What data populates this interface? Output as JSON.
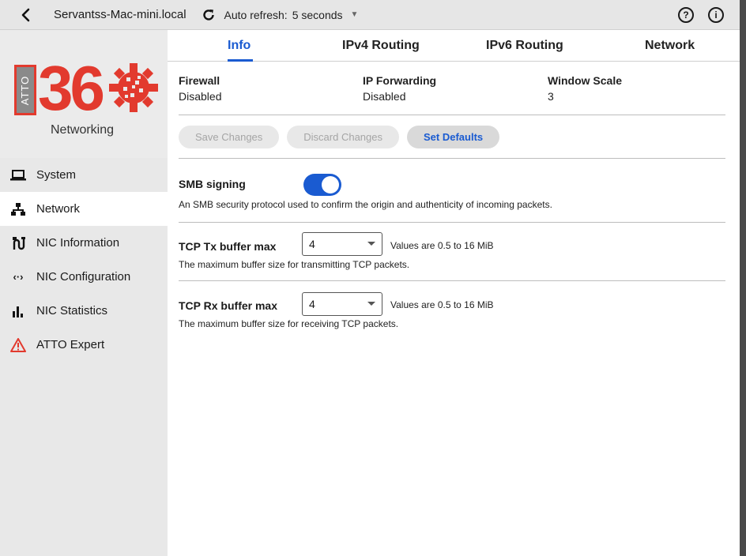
{
  "topbar": {
    "host": "Servantss-Mac-mini.local",
    "refresh_label": "Auto refresh:",
    "refresh_value": "5 seconds"
  },
  "logo": {
    "box_text": "ATTO",
    "number": "36",
    "subtitle": "Networking"
  },
  "sidebar": {
    "items": [
      {
        "label": "System",
        "icon": "laptop-icon"
      },
      {
        "label": "Network",
        "icon": "network-icon",
        "active": true
      },
      {
        "label": "NIC Information",
        "icon": "nic-information-icon"
      },
      {
        "label": "NIC Configuration",
        "icon": "code-arrows-icon"
      },
      {
        "label": "NIC Statistics",
        "icon": "bar-chart-icon"
      },
      {
        "label": "ATTO Expert",
        "icon": "warning-icon"
      }
    ]
  },
  "tabs": [
    {
      "label": "Info",
      "active": true
    },
    {
      "label": "IPv4 Routing"
    },
    {
      "label": "IPv6 Routing"
    },
    {
      "label": "Network"
    }
  ],
  "info": {
    "firewall_label": "Firewall",
    "firewall_value": "Disabled",
    "ipfwd_label": "IP Forwarding",
    "ipfwd_value": "Disabled",
    "winscale_label": "Window Scale",
    "winscale_value": "3"
  },
  "buttons": {
    "save": "Save Changes",
    "discard": "Discard Changes",
    "defaults": "Set Defaults"
  },
  "smb": {
    "title": "SMB signing",
    "desc": "An SMB security protocol used to confirm the origin and authenticity of incoming packets.",
    "enabled": true
  },
  "tcp_tx": {
    "title": "TCP Tx buffer max",
    "value": "4",
    "range": "Values are 0.5 to 16 MiB",
    "desc": "The maximum buffer size for transmitting TCP packets."
  },
  "tcp_rx": {
    "title": "TCP Rx buffer max",
    "value": "4",
    "range": "Values are 0.5 to 16 MiB",
    "desc": "The maximum buffer size for receiving TCP packets."
  },
  "colors": {
    "accent": "#1a5bd1",
    "brand": "#e23a2e"
  }
}
